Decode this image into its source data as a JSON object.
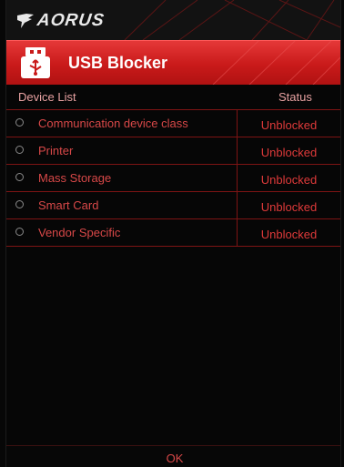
{
  "app": {
    "brand": "AORUS",
    "title": "USB Blocker"
  },
  "columns": {
    "device": "Device List",
    "status": "Status"
  },
  "devices": [
    {
      "name": "Communication device class",
      "status": "Unblocked"
    },
    {
      "name": "Printer",
      "status": "Unblocked"
    },
    {
      "name": "Mass Storage",
      "status": "Unblocked"
    },
    {
      "name": "Smart Card",
      "status": "Unblocked"
    },
    {
      "name": "Vendor Specific",
      "status": "Unblocked"
    }
  ],
  "footer": {
    "ok_label": "OK"
  },
  "colors": {
    "accent": "#d42626",
    "status_text": "#df3a3a",
    "background": "#060606"
  }
}
